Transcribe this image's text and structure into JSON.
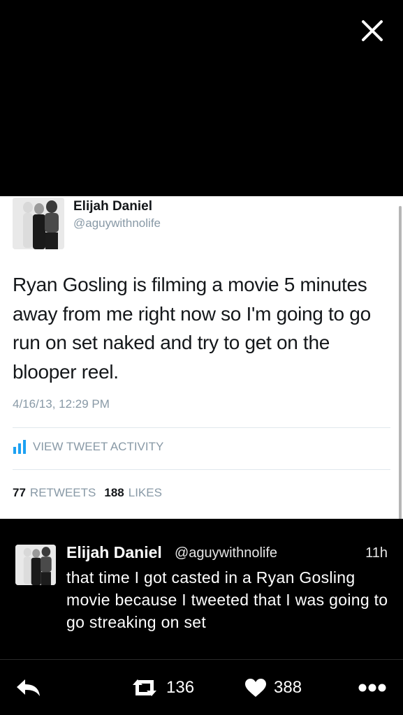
{
  "embedded_tweet": {
    "name": "Elijah Daniel",
    "handle": "@aguywithnolife",
    "text": "Ryan Gosling is filming a movie 5 minutes away from me right now so I'm going to go run on set naked and try to get on the blooper reel.",
    "date": "4/16/13, 12:29 PM",
    "activity_label": "VIEW TWEET ACTIVITY",
    "retweets_count": "77",
    "retweets_label": "RETWEETS",
    "likes_count": "188",
    "likes_label": "LIKES"
  },
  "tweet": {
    "name": "Elijah Daniel",
    "handle": "@aguywithnolife",
    "time": "11h",
    "text": "that time I got casted in a Ryan Gosling movie because I tweeted that I was going to go streaking on set"
  },
  "actions": {
    "retweet_count": "136",
    "like_count": "388"
  },
  "icons": {
    "close": "close-icon",
    "reply": "reply-icon",
    "retweet": "retweet-icon",
    "like": "heart-icon",
    "more": "more-icon",
    "activity": "bar-chart-icon"
  },
  "colors": {
    "background": "#000000",
    "card": "#ffffff",
    "muted_text": "#8899a6"
  }
}
